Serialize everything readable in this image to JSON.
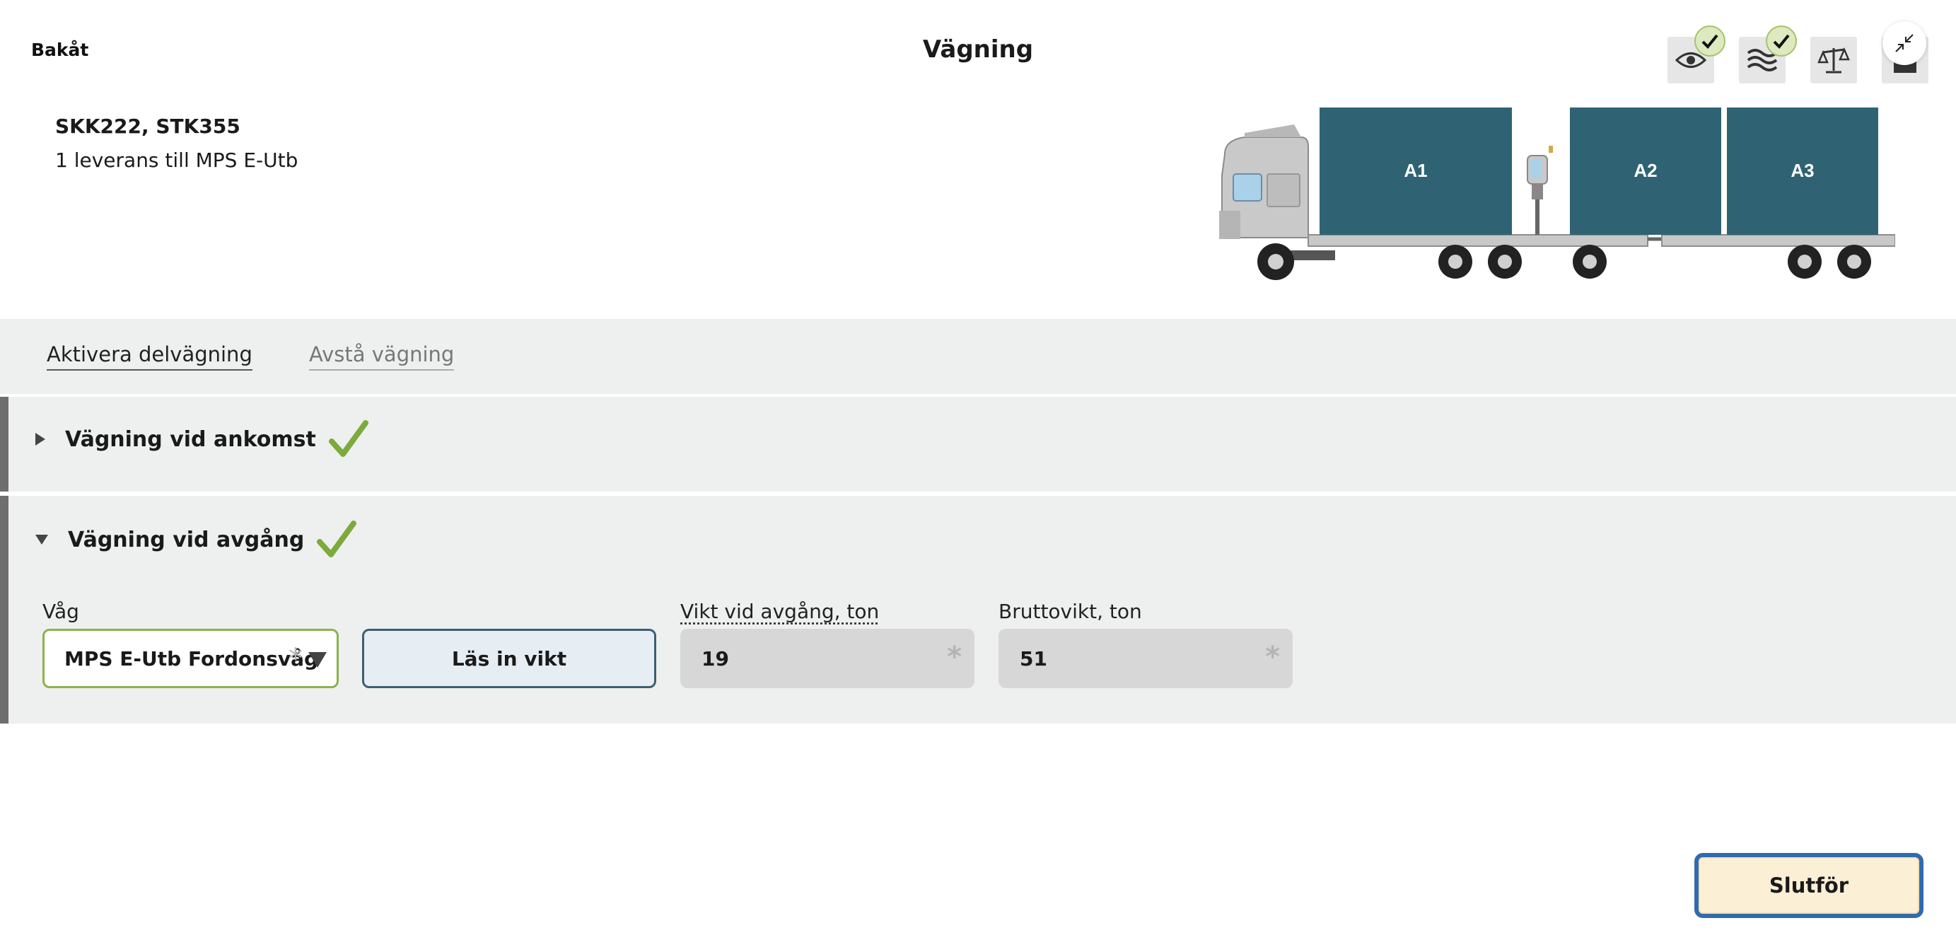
{
  "header": {
    "back_label": "Bakåt",
    "title": "Vägning"
  },
  "status_icons": [
    {
      "icon": "eye-icon",
      "checked": true
    },
    {
      "icon": "waves-icon",
      "checked": true
    },
    {
      "icon": "scale-icon",
      "checked": false
    },
    {
      "icon": "home-icon",
      "checked": false
    }
  ],
  "vehicle": {
    "ids": "SKK222, STK355",
    "delivery": "1 leverans till MPS E-Utb",
    "compartments": [
      "A1",
      "A2",
      "A3"
    ]
  },
  "actions": {
    "activate_partial": "Aktivera delvägning",
    "skip_weighing": "Avstå vägning"
  },
  "sections": {
    "arrival": {
      "title": "Vägning vid ankomst",
      "done": true,
      "expanded": false
    },
    "departure": {
      "title": "Vägning vid avgång",
      "done": true,
      "expanded": true
    }
  },
  "departure_form": {
    "scale_label": "Våg",
    "scale_value": "MPS E-Utb Fordonsvåg",
    "read_button": "Läs in vikt",
    "weight_label": "Vikt vid avgång, ton",
    "weight_value": "19",
    "gross_label": "Bruttovikt, ton",
    "gross_value": "51"
  },
  "footer": {
    "finish_label": "Slutför"
  },
  "colors": {
    "compartment": "#2f6374",
    "check_green": "#7daa3c",
    "section_bg": "#eef0ef",
    "primary_border": "#2f6bb0",
    "finish_bg": "#fbefd6"
  }
}
